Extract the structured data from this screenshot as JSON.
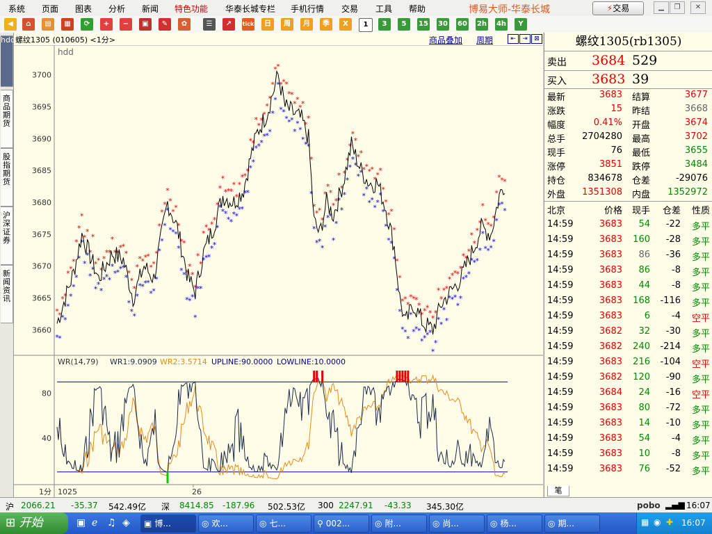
{
  "menu": {
    "items": [
      "系统",
      "页面",
      "图表",
      "分析",
      "新闻",
      "特色功能",
      "华泰长城专栏",
      "手机行情",
      "交易",
      "工具",
      "帮助"
    ],
    "app_title": "博易大师-华泰长城",
    "trade_button": "交易"
  },
  "toolbar": {
    "numbers": [
      "1",
      "3",
      "5",
      "15",
      "30",
      "60",
      "2h",
      "4h",
      "Y"
    ],
    "calendar": [
      "日",
      "周",
      "月",
      "季",
      "X"
    ]
  },
  "sidebar": {
    "tabs": [
      "商品期货",
      "股指期货",
      "沪深证券",
      "新闻资讯"
    ],
    "top_tab": "hdd"
  },
  "chart_header": {
    "title": "螺纹1305 (010605) <1分>",
    "overlay_link": "商品叠加",
    "period_link": "周期",
    "series_name": "hdd"
  },
  "indicator": {
    "label": "WR(14,79)",
    "wr1": "WR1:9.0909",
    "wr2": "WR2:3.5714",
    "upline": "UPLINE:90.0000",
    "lowline": "LOWLINE:10.0000",
    "yticks": [
      "80",
      "40"
    ]
  },
  "xaxis": {
    "period": "1分",
    "label_start": "1025",
    "label_mid": "26"
  },
  "chart_data": {
    "type": "line",
    "title": "螺纹1305 (010605) <1分>",
    "ylim": [
      3656,
      3704
    ],
    "yticks": [
      3700,
      3695,
      3690,
      3685,
      3680,
      3675,
      3670,
      3665,
      3660
    ],
    "x_labels": [
      "1025",
      "26"
    ],
    "anchors": [
      [
        0,
        3661
      ],
      [
        6,
        3665
      ],
      [
        12,
        3669
      ],
      [
        18,
        3675
      ],
      [
        25,
        3671
      ],
      [
        30,
        3668
      ],
      [
        40,
        3672
      ],
      [
        48,
        3671
      ],
      [
        55,
        3665
      ],
      [
        63,
        3670
      ],
      [
        70,
        3668
      ],
      [
        80,
        3680
      ],
      [
        87,
        3676
      ],
      [
        95,
        3668
      ],
      [
        100,
        3666
      ],
      [
        106,
        3672
      ],
      [
        113,
        3676
      ],
      [
        120,
        3681
      ],
      [
        128,
        3680
      ],
      [
        135,
        3682
      ],
      [
        140,
        3687
      ],
      [
        145,
        3691
      ],
      [
        152,
        3694
      ],
      [
        160,
        3700
      ],
      [
        165,
        3695
      ],
      [
        171,
        3694
      ],
      [
        177,
        3693
      ],
      [
        182,
        3690
      ],
      [
        186,
        3677
      ],
      [
        190,
        3675
      ],
      [
        195,
        3680
      ],
      [
        200,
        3678
      ],
      [
        207,
        3683
      ],
      [
        213,
        3689
      ],
      [
        220,
        3685
      ],
      [
        226,
        3683
      ],
      [
        232,
        3683
      ],
      [
        238,
        3679
      ],
      [
        244,
        3673
      ],
      [
        248,
        3665
      ],
      [
        252,
        3661
      ],
      [
        258,
        3664
      ],
      [
        265,
        3661
      ],
      [
        272,
        3660
      ],
      [
        278,
        3664
      ],
      [
        285,
        3666
      ],
      [
        292,
        3668
      ],
      [
        300,
        3672
      ],
      [
        307,
        3676
      ],
      [
        314,
        3675
      ],
      [
        320,
        3681
      ],
      [
        324,
        3683
      ]
    ],
    "wr_levels": {
      "upline": 90,
      "lowline": 10
    }
  },
  "quote": {
    "name": "螺纹1305(rb1305)",
    "sell_label": "卖出",
    "sell_price": "3684",
    "sell_vol": "529",
    "buy_label": "买入",
    "buy_price": "3683",
    "buy_vol": "39",
    "rows": [
      {
        "l1": "最新",
        "v1": "3683",
        "c1": "red",
        "l2": "结算",
        "v2": "3677",
        "c2": "red"
      },
      {
        "l1": "涨跌",
        "v1": "15",
        "c1": "red",
        "l2": "昨结",
        "v2": "3668",
        "c2": "gray"
      },
      {
        "l1": "幅度",
        "v1": "0.41%",
        "c1": "red",
        "l2": "开盘",
        "v2": "3674",
        "c2": "red"
      },
      {
        "l1": "总手",
        "v1": "2704280",
        "c1": "",
        "l2": "最高",
        "v2": "3702",
        "c2": "red"
      },
      {
        "l1": "现手",
        "v1": "76",
        "c1": "",
        "l2": "最低",
        "v2": "3655",
        "c2": "grn"
      },
      {
        "l1": "涨停",
        "v1": "3851",
        "c1": "red",
        "l2": "跌停",
        "v2": "3484",
        "c2": "grn"
      },
      {
        "l1": "持仓",
        "v1": "834678",
        "c1": "",
        "l2": "仓差",
        "v2": "-29076",
        "c2": ""
      },
      {
        "l1": "外盘",
        "v1": "1351308",
        "c1": "red",
        "l2": "内盘",
        "v2": "1352972",
        "c2": "grn"
      }
    ],
    "tick_headers": [
      "北京",
      "价格",
      "现手",
      "仓差",
      "性质"
    ],
    "ticks": [
      [
        "14:59",
        "3683",
        "54",
        "-22",
        "多平"
      ],
      [
        "14:59",
        "3683",
        "160",
        "-28",
        "多平"
      ],
      [
        "14:59",
        "3683",
        "86",
        "-36",
        "多平"
      ],
      [
        "14:59",
        "3683",
        "86",
        "-8",
        "多平"
      ],
      [
        "14:59",
        "3683",
        "44",
        "-8",
        "多平"
      ],
      [
        "14:59",
        "3683",
        "168",
        "-116",
        "多平"
      ],
      [
        "14:59",
        "3683",
        "6",
        "-4",
        "空平"
      ],
      [
        "14:59",
        "3682",
        "32",
        "-30",
        "多平"
      ],
      [
        "14:59",
        "3682",
        "240",
        "-214",
        "多平"
      ],
      [
        "14:59",
        "3683",
        "216",
        "-104",
        "空平"
      ],
      [
        "14:59",
        "3682",
        "120",
        "-90",
        "多平"
      ],
      [
        "14:59",
        "3684",
        "24",
        "-16",
        "空平"
      ],
      [
        "14:59",
        "3683",
        "80",
        "-72",
        "多平"
      ],
      [
        "14:59",
        "3683",
        "14",
        "-10",
        "多平"
      ],
      [
        "14:59",
        "3683",
        "54",
        "-4",
        "多平"
      ],
      [
        "14:59",
        "3683",
        "10",
        "-8",
        "多平"
      ],
      [
        "14:59",
        "3683",
        "76",
        "-52",
        "多平"
      ]
    ],
    "bottom_tab": "笔"
  },
  "statusbar": {
    "sh_label": "沪",
    "sh_index": "2066.21",
    "sh_chg": "-35.37",
    "sh_amt": "542.49亿",
    "sz_label": "深",
    "sz_index": "8414.85",
    "sz_chg": "-187.96",
    "sz_amt": "502.53亿",
    "i300_label": "300",
    "i300_index": "2247.91",
    "i300_chg": "-43.33",
    "i300_amt": "345.30亿",
    "brand": "pobo",
    "time": "16:07"
  },
  "taskbar": {
    "start": "开始",
    "tasks": [
      "博...",
      "欢...",
      "七...",
      "002...",
      "附...",
      "尚...",
      "杨...",
      "期..."
    ],
    "time": "16:07"
  },
  "colors": {
    "red_star": "#e00000",
    "blue_star": "#0000dd",
    "price_line": "#000000",
    "wr1": "#1a2a4a",
    "wr2": "#e88a1a",
    "level_line": "#000080"
  }
}
